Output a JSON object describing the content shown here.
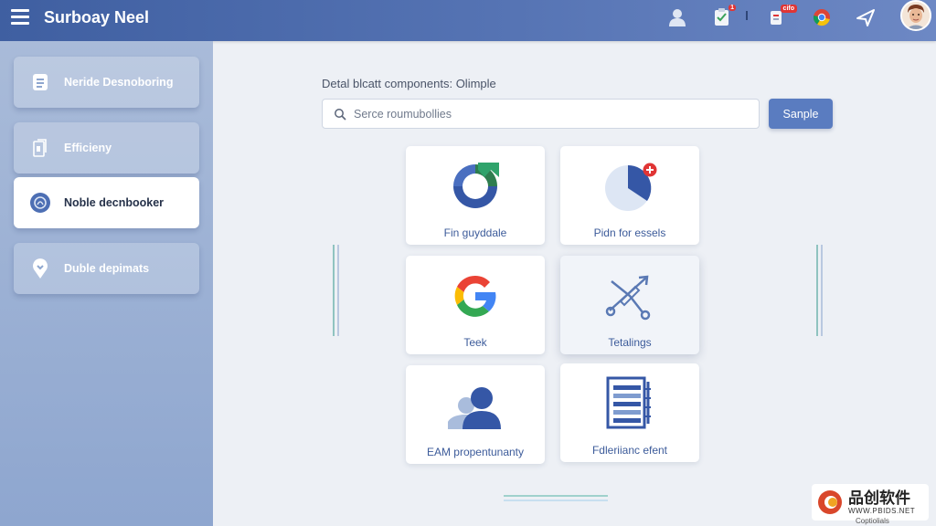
{
  "header": {
    "title": "Surboay Neel",
    "icons": [
      "menu-icon",
      "user-icon",
      "clipboard-icon",
      "notification-icon",
      "chrome-icon",
      "send-icon"
    ],
    "badge_1": "1",
    "badge_2": "cifo",
    "colors": {
      "start": "#3f5fa1",
      "end": "#6d88c4"
    }
  },
  "sidebar": {
    "items": [
      {
        "label": "Neride Desnoboring",
        "icon": "document-icon",
        "active": false
      },
      {
        "label": "Efficieny",
        "icon": "file-icon",
        "active": false
      },
      {
        "label": "Noble decnbooker",
        "icon": "shield-icon",
        "active": true
      },
      {
        "label": "Duble depimats",
        "icon": "location-pin-icon",
        "active": false
      }
    ]
  },
  "main": {
    "subtitle": "Detal blcatt components: Olimple",
    "search": {
      "placeholder": "Serce roumubollies",
      "value": ""
    },
    "sample_button": "Sanple",
    "tiles": [
      {
        "label": "Fin guyddale",
        "icon": "ring-chart-icon"
      },
      {
        "label": "Pidn for essels",
        "icon": "pie-chart-icon"
      },
      {
        "label": "Teek",
        "icon": "google-icon"
      },
      {
        "label": "Tetalings",
        "icon": "tools-icon"
      },
      {
        "label": "EAM propentunanty",
        "icon": "users-icon"
      },
      {
        "label": "Fdleriianc efent",
        "icon": "list-document-icon"
      }
    ]
  },
  "watermark": {
    "cn": "品创软件",
    "url": "WWW.PBIDS.NET",
    "sub": "Coptiolials"
  }
}
